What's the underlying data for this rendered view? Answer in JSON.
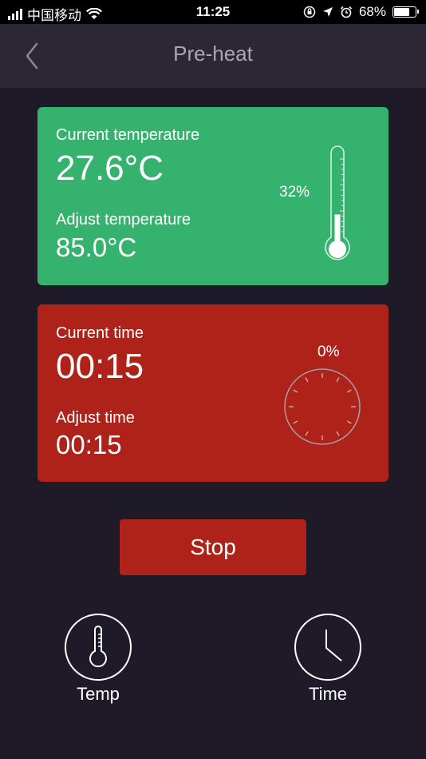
{
  "status_bar": {
    "carrier": "中国移动",
    "time": "11:25",
    "battery_percent": "68%",
    "battery_level": 0.68
  },
  "nav": {
    "title": "Pre-heat"
  },
  "temperature_card": {
    "current_label": "Current temperature",
    "current_value": "27.6°C",
    "adjust_label": "Adjust temperature",
    "adjust_value": "85.0°C",
    "progress_label": "32%",
    "progress": 0.32,
    "color": "#35b36e"
  },
  "time_card": {
    "current_label": "Current time",
    "current_value": "00:15",
    "adjust_label": "Adjust time",
    "adjust_value": "00:15",
    "progress_label": "0%",
    "progress": 0,
    "color": "#af2219"
  },
  "stop_button": {
    "label": "Stop"
  },
  "tabs": [
    {
      "label": "Temp",
      "icon": "thermometer-icon"
    },
    {
      "label": "Time",
      "icon": "clock-icon"
    }
  ],
  "colors": {
    "background": "#1e1a28",
    "navbar": "#2b2734",
    "title": "#a9a6b0"
  }
}
